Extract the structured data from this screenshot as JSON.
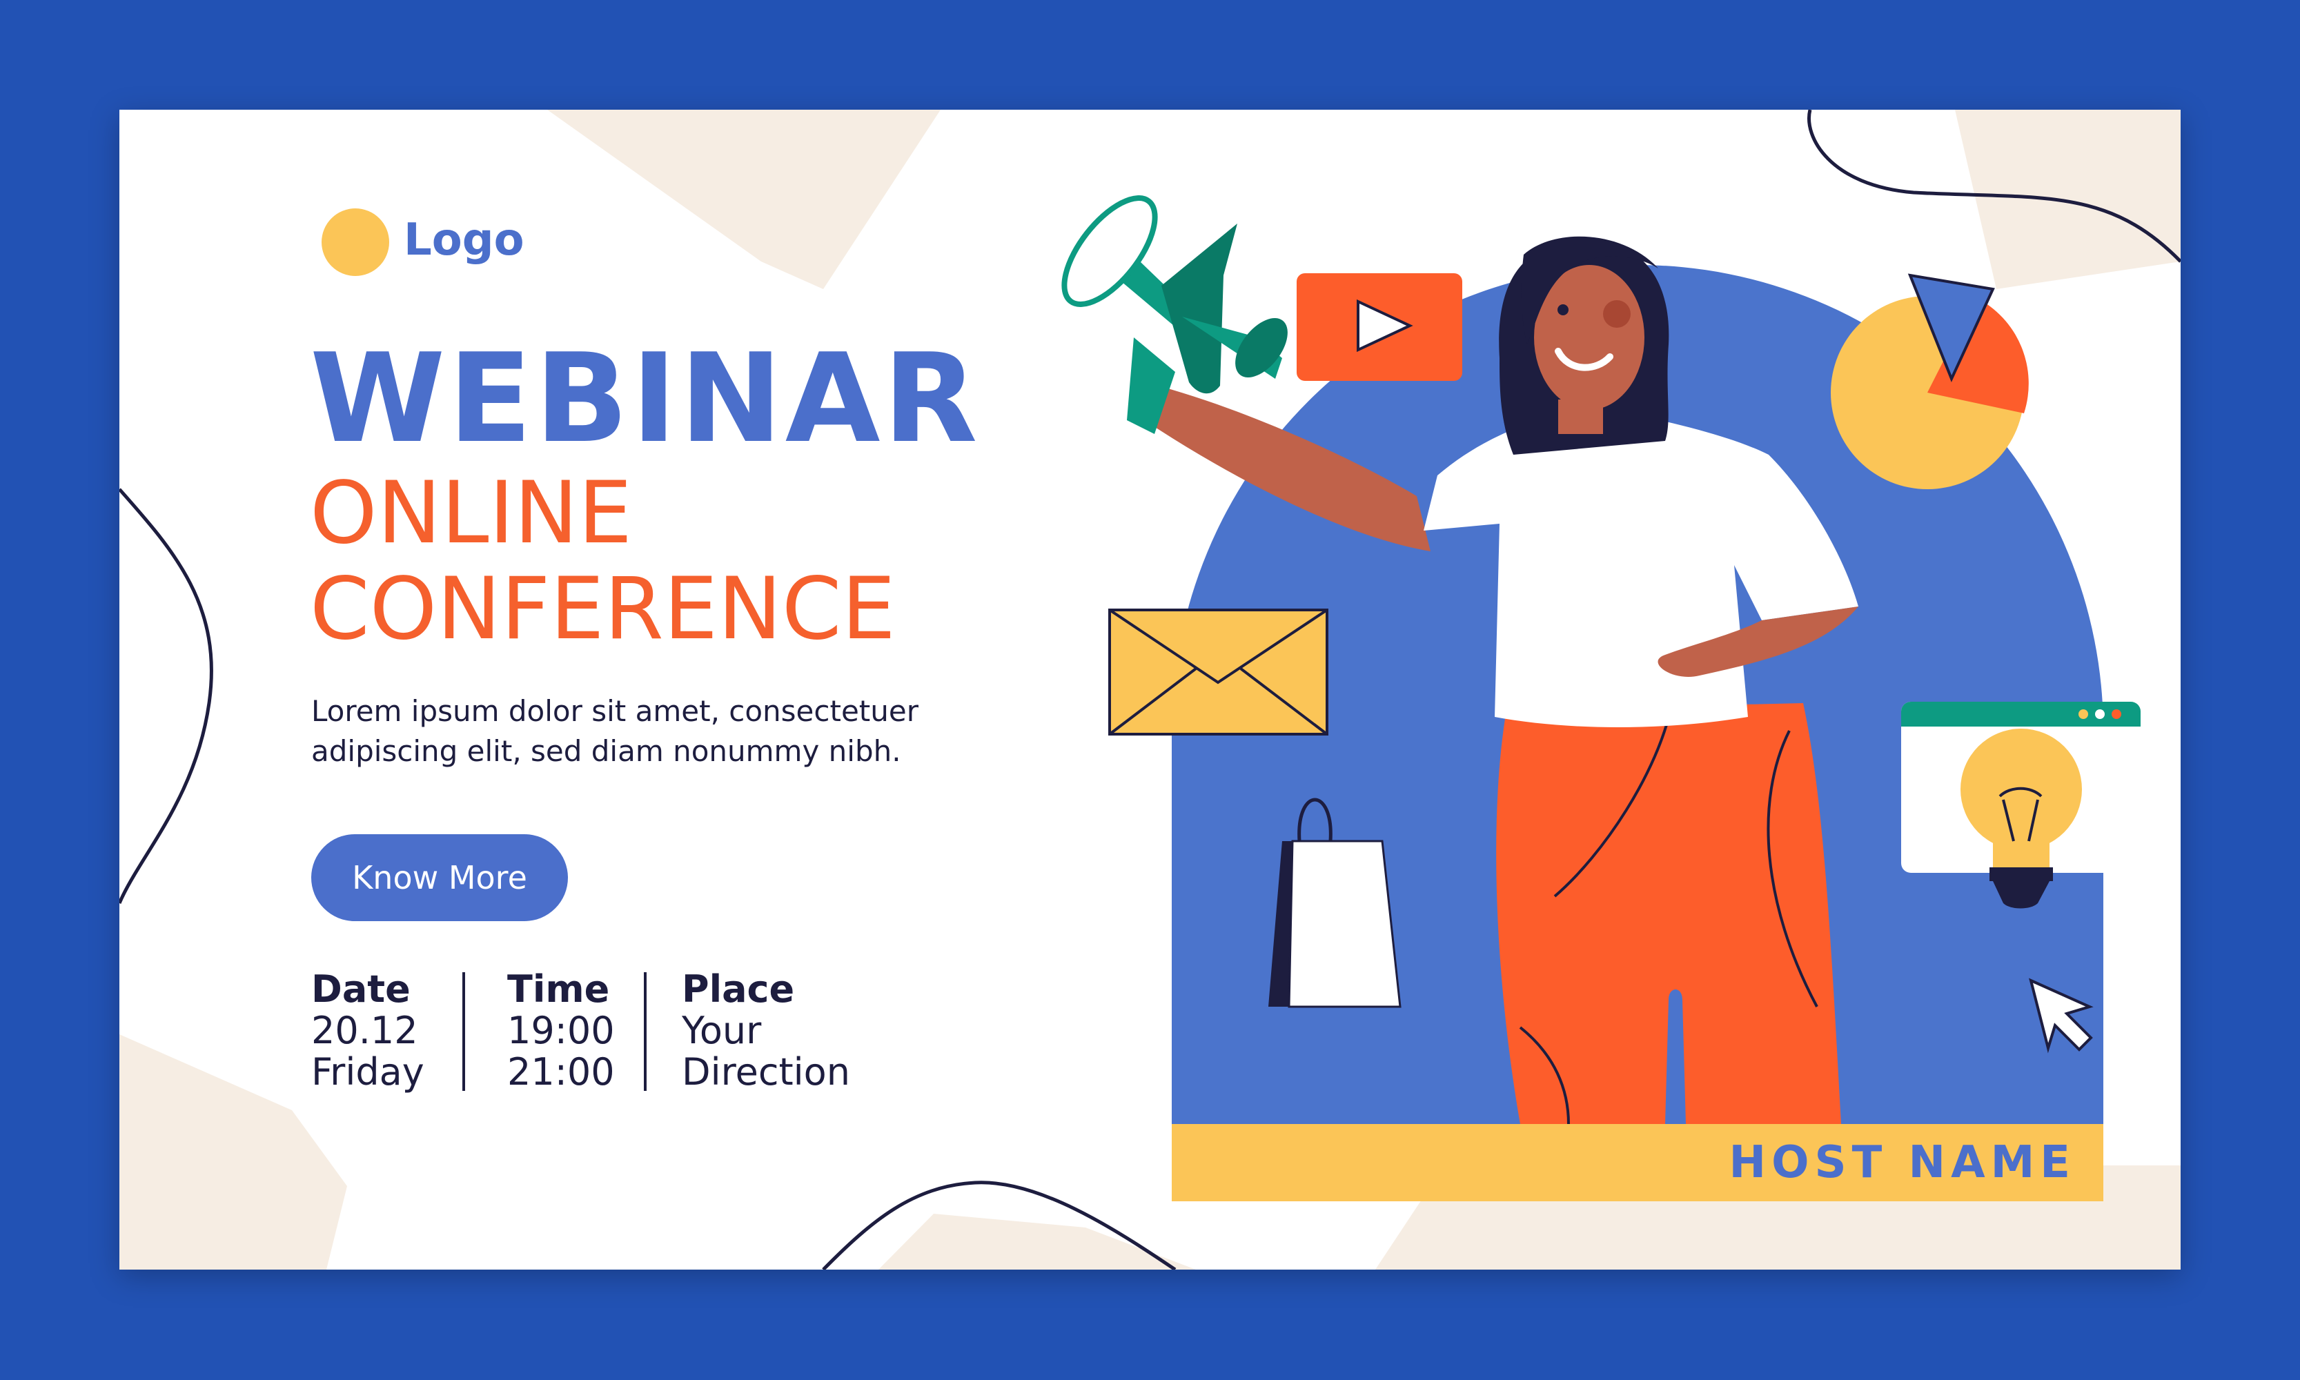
{
  "brand": {
    "logo_label": "Logo"
  },
  "hero": {
    "title": "WEBINAR",
    "subtitle_line1": "ONLINE",
    "subtitle_line2": "CONFERENCE",
    "description_line1": "Lorem ipsum dolor sit amet, consectetuer",
    "description_line2": "adipiscing elit, sed diam nonummy nibh.",
    "cta_label": "Know More"
  },
  "event_info": {
    "date": {
      "label": "Date",
      "line1": "20.12",
      "line2": "Friday"
    },
    "time": {
      "label": "Time",
      "line1": "19:00",
      "line2": "21:00"
    },
    "place": {
      "label": "Place",
      "line1": "Your",
      "line2": "Direction"
    }
  },
  "host": {
    "name": "HOST NAME"
  },
  "colors": {
    "page_background": "#2252b4",
    "card_background": "#ffffff",
    "accent_blue": "#4b6fcb",
    "accent_orange": "#f5602d",
    "accent_yellow": "#fbc557",
    "accent_teal": "#0d9b82",
    "ink": "#1d1d3f",
    "beige": "#f6ede3"
  },
  "icons": [
    "megaphone-icon",
    "play-icon",
    "mail-icon",
    "shopping-bag-icon",
    "pie-chart-icon",
    "browser-window-icon",
    "lightbulb-icon",
    "cursor-arrow-icon"
  ]
}
